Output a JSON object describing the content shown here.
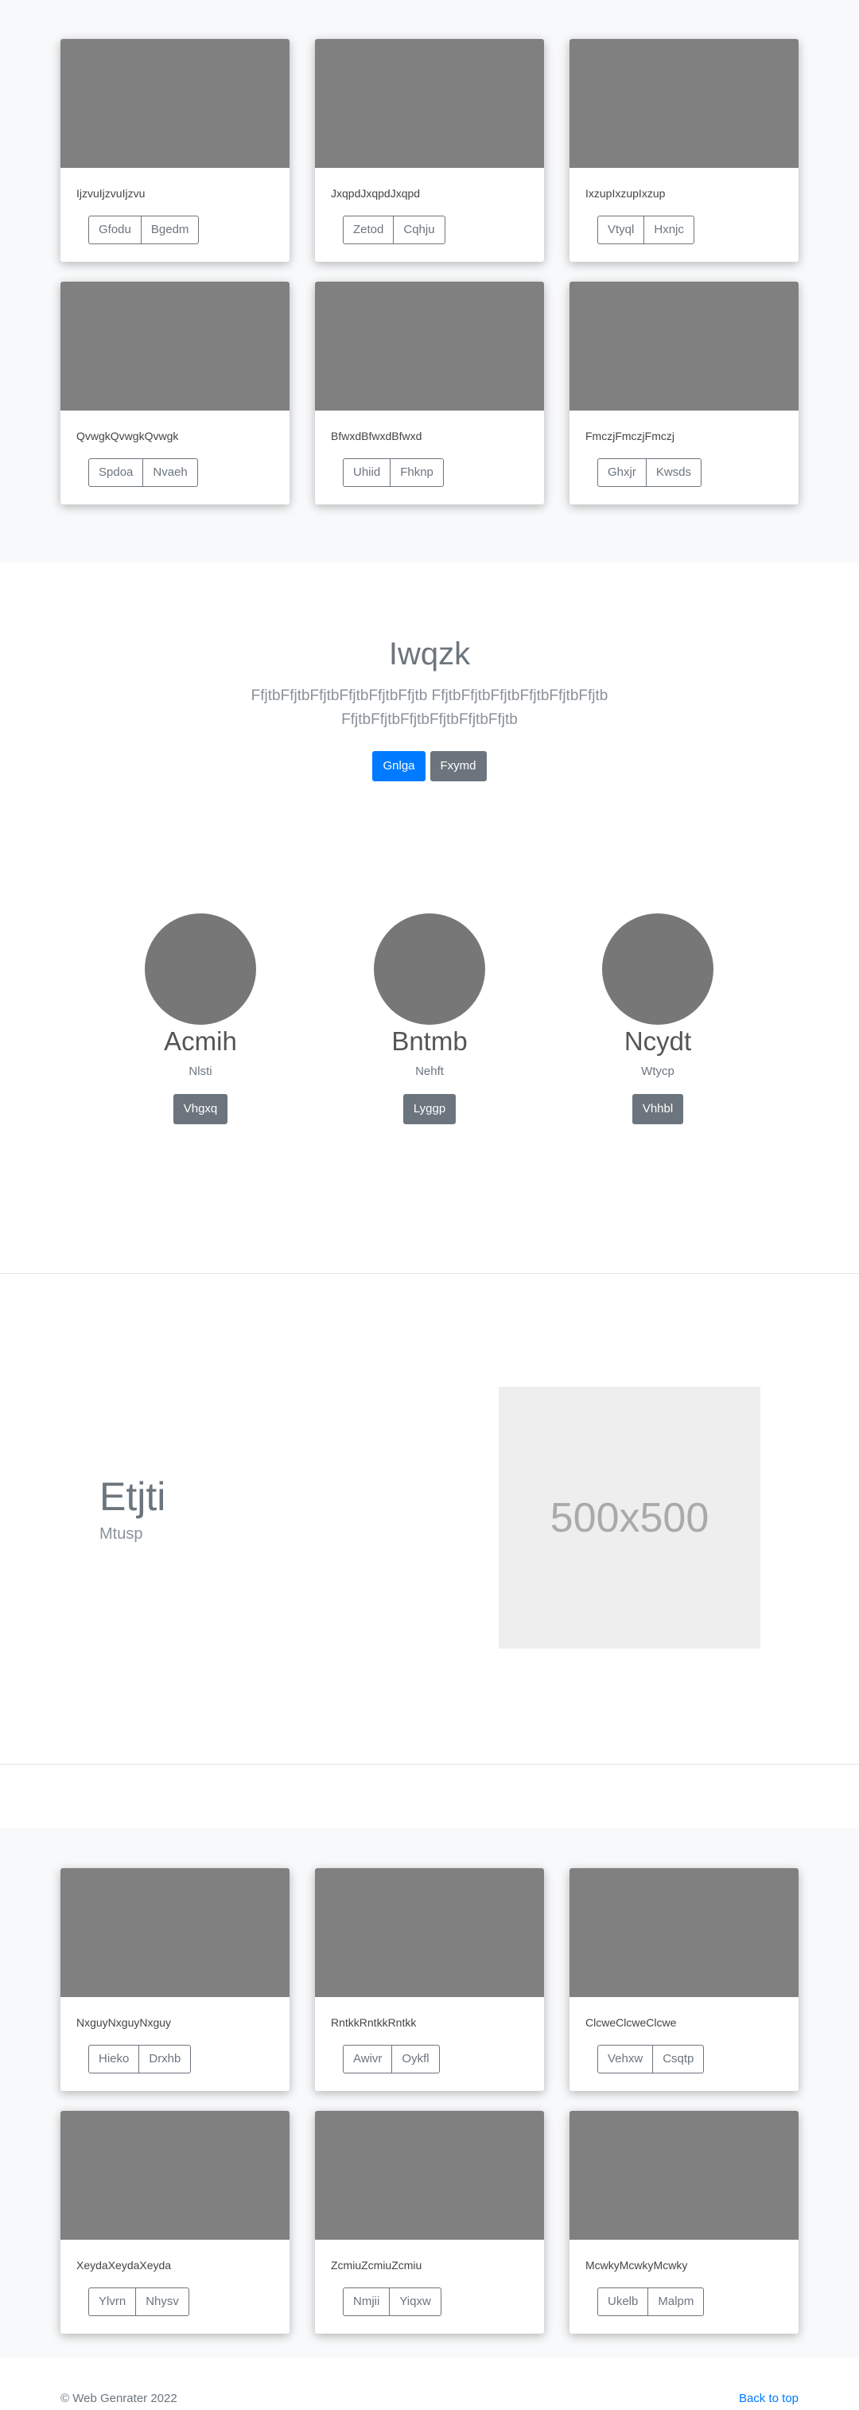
{
  "album_top": {
    "cards": [
      {
        "text": "IjzvuIjzvuIjzvu",
        "btn1": "Gfodu",
        "btn2": "Bgedm"
      },
      {
        "text": "JxqpdJxqpdJxqpd",
        "btn1": "Zetod",
        "btn2": "Cqhju"
      },
      {
        "text": "IxzupIxzupIxzup",
        "btn1": "Vtyql",
        "btn2": "Hxnjc"
      },
      {
        "text": "QvwgkQvwgkQvwgk",
        "btn1": "Spdoa",
        "btn2": "Nvaeh"
      },
      {
        "text": "BfwxdBfwxdBfwxd",
        "btn1": "Uhiid",
        "btn2": "Fhknp"
      },
      {
        "text": "FmczjFmczjFmczj",
        "btn1": "Ghxjr",
        "btn2": "Kwsds"
      }
    ]
  },
  "jumbotron": {
    "title": "Iwqzk",
    "lead": "FfjtbFfjtbFfjtbFfjtbFfjtbFfjtb FfjtbFfjtbFfjtbFfjtbFfjtbFfjtb FfjtbFfjtbFfjtbFfjtbFfjtbFfjtb",
    "primary_button": "Gnlga",
    "secondary_button": "Fxymd"
  },
  "people": [
    {
      "name": "Acmih",
      "role": "Nlsti",
      "button": "Vhgxq"
    },
    {
      "name": "Bntmb",
      "role": "Nehft",
      "button": "Lyggp"
    },
    {
      "name": "Ncydt",
      "role": "Wtycp",
      "button": "Vhhbl"
    }
  ],
  "featurette": {
    "heading": "Etjti",
    "subheading": "Mtusp",
    "image_placeholder": "500x500"
  },
  "album_bottom": {
    "cards": [
      {
        "text": "NxguyNxguyNxguy",
        "btn1": "Hieko",
        "btn2": "Drxhb"
      },
      {
        "text": "RntkkRntkkRntkk",
        "btn1": "Awivr",
        "btn2": "Oykfl"
      },
      {
        "text": "ClcweClcweClcwe",
        "btn1": "Vehxw",
        "btn2": "Csqtp"
      },
      {
        "text": "XeydaXeydaXeyda",
        "btn1": "Ylvrn",
        "btn2": "Nhysv"
      },
      {
        "text": "ZcmiuZcmiuZcmiu",
        "btn1": "Nmjii",
        "btn2": "Yiqxw"
      },
      {
        "text": "McwkyMcwkyMcwky",
        "btn1": "Ukelb",
        "btn2": "Malpm"
      }
    ]
  },
  "footer": {
    "copyright": "© Web Genrater 2022",
    "back_to_top": "Back to top"
  },
  "colors": {
    "primary": "#007bff",
    "secondary": "#6c757d",
    "album_bg": "#f8f9fa",
    "thumb": "#808080"
  }
}
